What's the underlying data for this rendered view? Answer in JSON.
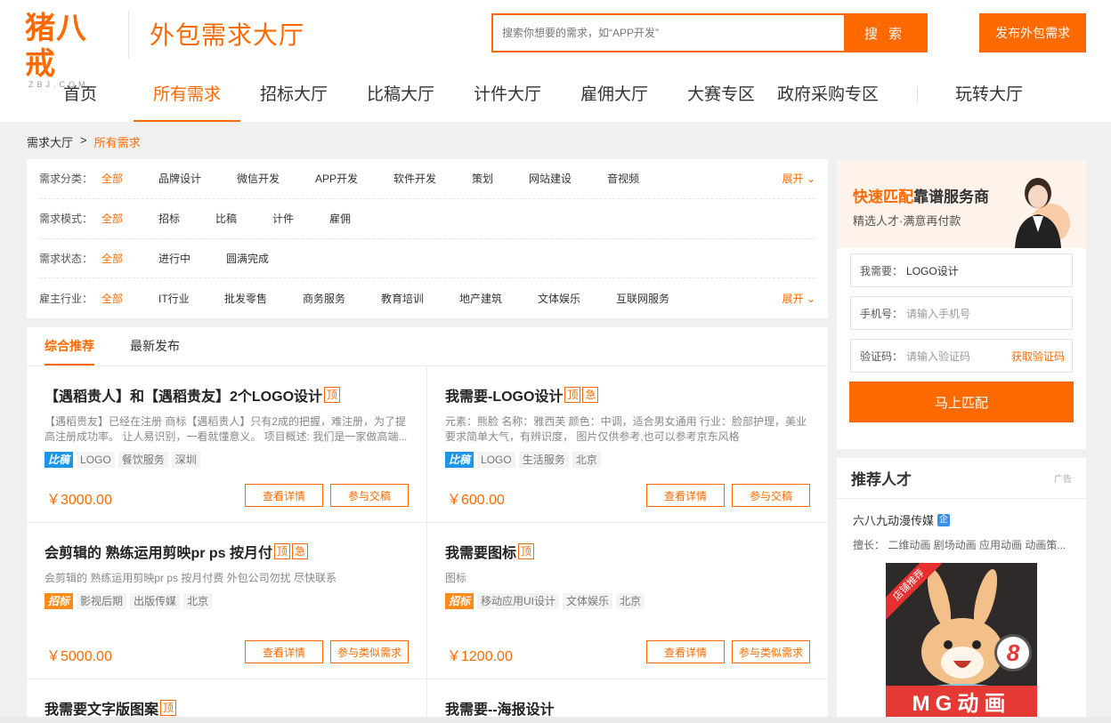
{
  "header": {
    "logo_text": "猪八戒",
    "logo_sub": "ZBJ.COM",
    "site_title": "外包需求大厅",
    "search_placeholder": "搜索你想要的需求，如“APP开发”",
    "search_button": "搜 索",
    "publish_button": "发布外包需求"
  },
  "nav": {
    "items": [
      "首页",
      "所有需求",
      "招标大厅",
      "比稿大厅",
      "计件大厅",
      "雇佣大厅",
      "大赛专区",
      "政府采购专区",
      "玩转大厅"
    ],
    "active": "所有需求"
  },
  "breadcrumb": {
    "root": "需求大厅",
    "separator": ">",
    "current": "所有需求"
  },
  "filters": [
    {
      "label": "需求分类：",
      "options": [
        "全部",
        "品牌设计",
        "微信开发",
        "APP开发",
        "软件开发",
        "策划",
        "网站建设",
        "音视频"
      ],
      "expand": "展开"
    },
    {
      "label": "需求模式：",
      "options": [
        "全部",
        "招标",
        "比稿",
        "计件",
        "雇佣"
      ],
      "expand": ""
    },
    {
      "label": "需求状态：",
      "options": [
        "全部",
        "进行中",
        "圆满完成"
      ],
      "expand": ""
    },
    {
      "label": "雇主行业：",
      "options": [
        "全部",
        "IT行业",
        "批发零售",
        "商务服务",
        "教育培训",
        "地产建筑",
        "文体娱乐",
        "互联网服务"
      ],
      "expand": "展开"
    }
  ],
  "tabs": [
    "综合推荐",
    "最新发布"
  ],
  "cards": [
    {
      "title": "【遇稻贵人】和【遇稻贵友】2个LOGO设计",
      "badges": [
        "顶"
      ],
      "desc": "【遇稻贵友】已经在注册 商标【遇稻贵人】只有2成的把握，难注册，为了提高注册成功率。 让人易识别，一看就懂意义。 项目概述: 我们是一家做高端...",
      "type": "比稿",
      "tags": [
        "LOGO",
        "餐饮服务",
        "深圳"
      ],
      "price": "￥3000.00",
      "btn1": "查看详情",
      "btn2": "参与交稿"
    },
    {
      "title": "我需要-LOGO设计",
      "badges": [
        "顶",
        "急"
      ],
      "desc": "元素：熊脸 名称：雅西芙 颜色：中调，适合男女通用 行业：脸部护理，美业 要求简单大气，有辨识度， 图片仅供参考,也可以参考京东风格",
      "type": "比稿",
      "tags": [
        "LOGO",
        "生活服务",
        "北京"
      ],
      "price": "￥600.00",
      "btn1": "查看详情",
      "btn2": "参与交稿"
    },
    {
      "title": "会剪辑的 熟练运用剪映pr ps 按月付",
      "badges": [
        "顶",
        "急"
      ],
      "desc": "会剪辑的 熟练运用剪映pr ps 按月付费 外包公司勿扰 尽快联系",
      "type": "招标",
      "tags": [
        "影视后期",
        "出版传媒",
        "北京"
      ],
      "price": "￥5000.00",
      "btn1": "查看详情",
      "btn2": "参与类似需求"
    },
    {
      "title": "我需要图标",
      "badges": [
        "顶"
      ],
      "desc": "图标",
      "type": "招标",
      "tags": [
        "移动应用UI设计",
        "文体娱乐",
        "北京"
      ],
      "price": "￥1200.00",
      "btn1": "查看详情",
      "btn2": "参与类似需求"
    },
    {
      "title": "我需要文字版图案",
      "badges": [
        "顶"
      ]
    },
    {
      "title": "我需要--海报设计",
      "badges": []
    }
  ],
  "match": {
    "title_highlight": "快速匹配",
    "title_rest": "靠谱服务商",
    "subtitle": "精选人才·满意再付款",
    "need_label": "我需要：",
    "need_value": "LOGO设计",
    "phone_label": "手机号：",
    "phone_placeholder": "请输入手机号",
    "code_label": "验证码：",
    "code_placeholder": "请输入验证码",
    "get_code": "获取验证码",
    "button": "马上匹配"
  },
  "talent": {
    "title": "推荐人才",
    "ad_label": "广告",
    "name": "六八九动漫传媒",
    "qi": "企",
    "skills": "擅长：  二维动画 剧场动画 应用动画 动画策...",
    "ribbon": "店铺推荐",
    "banner": "MG动画",
    "years": "8"
  },
  "colors": {
    "accent": "#ff6a00",
    "bijiao": "#1e96e8",
    "zhaobiao": "#ff8a1a"
  }
}
